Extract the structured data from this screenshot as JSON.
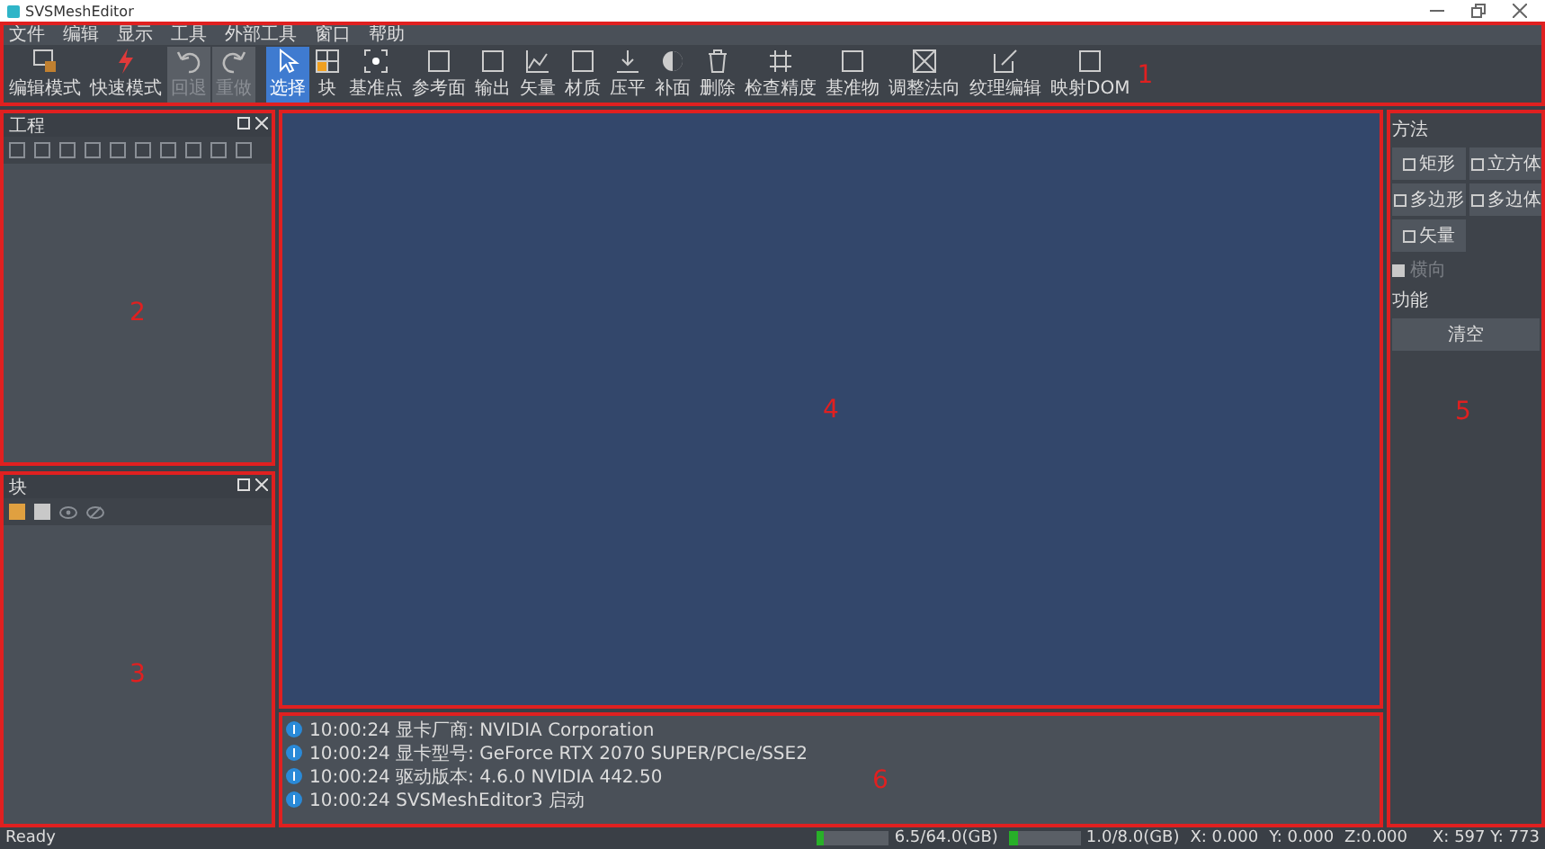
{
  "window": {
    "title": "SVSMeshEditor"
  },
  "menu": [
    "文件",
    "编辑",
    "显示",
    "工具",
    "外部工具",
    "窗口",
    "帮助"
  ],
  "toolbar": {
    "region_label": "1",
    "items": [
      {
        "label": "编辑模式",
        "selected": false,
        "disabled": false
      },
      {
        "label": "快速模式",
        "selected": false,
        "disabled": false
      },
      {
        "label": "回退",
        "selected": false,
        "disabled": true
      },
      {
        "label": "重做",
        "selected": false,
        "disabled": true
      },
      {
        "label": "选择",
        "selected": true,
        "disabled": false
      },
      {
        "label": "块",
        "selected": false,
        "disabled": false
      },
      {
        "label": "基准点",
        "selected": false,
        "disabled": false
      },
      {
        "label": "参考面",
        "selected": false,
        "disabled": false
      },
      {
        "label": "输出",
        "selected": false,
        "disabled": false
      },
      {
        "label": "矢量",
        "selected": false,
        "disabled": false
      },
      {
        "label": "材质",
        "selected": false,
        "disabled": false
      },
      {
        "label": "压平",
        "selected": false,
        "disabled": false
      },
      {
        "label": "补面",
        "selected": false,
        "disabled": false
      },
      {
        "label": "删除",
        "selected": false,
        "disabled": false
      },
      {
        "label": "检查精度",
        "selected": false,
        "disabled": false
      },
      {
        "label": "基准物",
        "selected": false,
        "disabled": false
      },
      {
        "label": "调整法向",
        "selected": false,
        "disabled": false
      },
      {
        "label": "纹理编辑",
        "selected": false,
        "disabled": false
      },
      {
        "label": "映射DOM",
        "selected": false,
        "disabled": false
      }
    ]
  },
  "project_panel": {
    "title": "工程",
    "region_label": "2"
  },
  "block_panel": {
    "title": "块",
    "region_label": "3"
  },
  "viewport": {
    "region_label": "4"
  },
  "right_panel": {
    "region_label": "5",
    "method_label": "方法",
    "buttons": [
      {
        "label": "矩形"
      },
      {
        "label": "立方体"
      },
      {
        "label": "多边形"
      },
      {
        "label": "多边体"
      },
      {
        "label": "矢量"
      }
    ],
    "checkbox": {
      "label": "横向",
      "checked": false,
      "disabled": true
    },
    "function_label": "功能",
    "clear_button": "清空"
  },
  "log": {
    "region_label": "6",
    "entries": [
      {
        "text": "10:00:24 显卡厂商: NVIDIA Corporation"
      },
      {
        "text": "10:00:24 显卡型号: GeForce RTX 2070 SUPER/PCIe/SSE2"
      },
      {
        "text": "10:00:24 驱动版本: 4.6.0 NVIDIA 442.50"
      },
      {
        "text": "10:00:24 SVSMeshEditor3 启动"
      }
    ]
  },
  "status_bar": {
    "message": "Ready",
    "memory": [
      {
        "text": "6.5/64.0(GB)",
        "level": 0.1
      },
      {
        "text": "1.0/8.0(GB)",
        "level": 0.125
      }
    ],
    "coords": [
      "X: 0.000",
      "Y: 0.000",
      "Z:0.000"
    ],
    "cursor": "X: 597  Y: 773"
  }
}
